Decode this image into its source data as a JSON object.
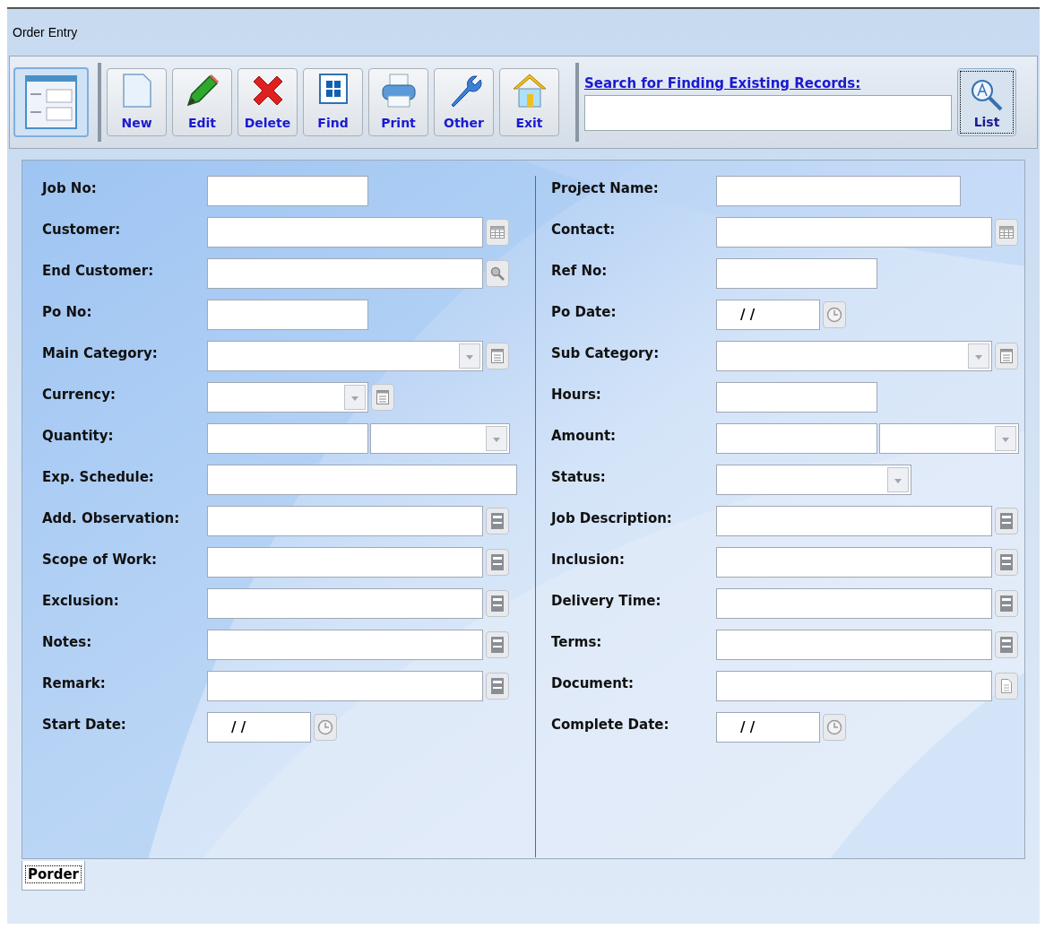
{
  "window": {
    "title": "Order Entry"
  },
  "toolbar": {
    "buttons": [
      {
        "label": "New"
      },
      {
        "label": "Edit"
      },
      {
        "label": "Delete"
      },
      {
        "label": "Find"
      },
      {
        "label": "Print"
      },
      {
        "label": "Other"
      },
      {
        "label": "Exit"
      }
    ],
    "search": {
      "link": "Search for Finding Existing Records:",
      "button": "List"
    }
  },
  "form": {
    "left": [
      {
        "label": "Job No:",
        "kind": "short_text"
      },
      {
        "label": "Customer:",
        "kind": "grid_lookup"
      },
      {
        "label": "End Customer:",
        "kind": "search_lookup"
      },
      {
        "label": "Po No:",
        "kind": "short_text"
      },
      {
        "label": "Main Category:",
        "kind": "long_combo_lookup"
      },
      {
        "label": "Currency:",
        "kind": "short_combo_lookup"
      },
      {
        "label": "Quantity:",
        "kind": "split"
      },
      {
        "label": "Exp. Schedule:",
        "kind": "wide_text"
      },
      {
        "label": "Add. Observation:",
        "kind": "memo"
      },
      {
        "label": "Scope of Work:",
        "kind": "memo"
      },
      {
        "label": "Exclusion:",
        "kind": "memo"
      },
      {
        "label": "Notes:",
        "kind": "memo"
      },
      {
        "label": "Remark:",
        "kind": "memo"
      },
      {
        "label": "Start Date:",
        "kind": "date",
        "value": "/ /"
      }
    ],
    "right": [
      {
        "label": "Project Name:",
        "kind": "medium_text"
      },
      {
        "label": "Contact:",
        "kind": "grid_lookup"
      },
      {
        "label": "Ref No:",
        "kind": "short_text"
      },
      {
        "label": "Po Date:",
        "kind": "date",
        "value": "/ /"
      },
      {
        "label": "Sub Category:",
        "kind": "long_combo_lookup"
      },
      {
        "label": "Hours:",
        "kind": "short_text"
      },
      {
        "label": "Amount:",
        "kind": "split"
      },
      {
        "label": "Status:",
        "kind": "combo"
      },
      {
        "label": "Job Description:",
        "kind": "memo"
      },
      {
        "label": "Inclusion:",
        "kind": "memo"
      },
      {
        "label": "Delivery Time:",
        "kind": "memo"
      },
      {
        "label": "Terms:",
        "kind": "memo"
      },
      {
        "label": "Document:",
        "kind": "document"
      },
      {
        "label": "Complete Date:",
        "kind": "date",
        "value": "/ /"
      }
    ]
  },
  "tabs": [
    {
      "label": "Porder",
      "selected": true
    }
  ]
}
